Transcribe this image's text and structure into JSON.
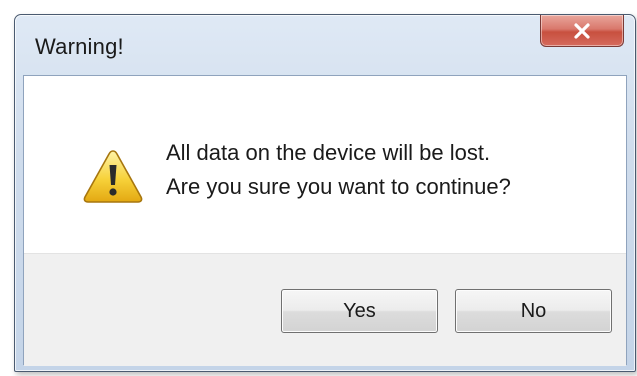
{
  "window": {
    "title": "Warning!",
    "close_icon": "close-x-icon"
  },
  "dialog": {
    "icon": "warning-triangle-icon",
    "message_lines": [
      "All data on the device will be lost.",
      "Are you sure you want to continue?"
    ]
  },
  "buttons": {
    "yes_label": "Yes",
    "no_label": "No"
  },
  "colors": {
    "close_button": "#d9786c",
    "warning_icon": "#f5c518",
    "client_background": "#ffffff",
    "button_strip": "#f0f0f0"
  }
}
